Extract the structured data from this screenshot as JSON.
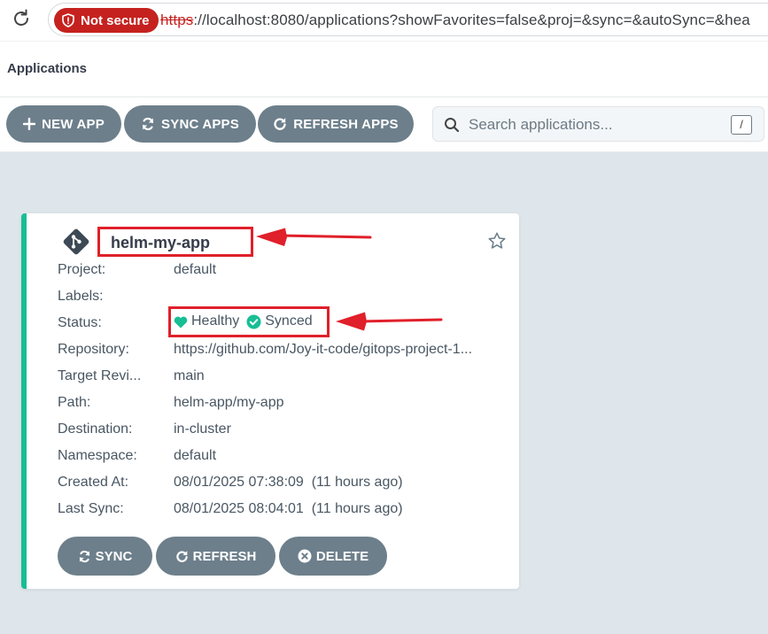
{
  "browser": {
    "security_label": "Not secure",
    "url_scheme": "https",
    "url_rest": "://localhost:8080/applications?showFavorites=false&proj=&sync=&autoSync=&hea"
  },
  "page": {
    "title": "Applications"
  },
  "toolbar": {
    "new_app_label": "NEW APP",
    "sync_apps_label": "SYNC APPS",
    "refresh_apps_label": "REFRESH APPS",
    "search_placeholder": "Search applications...",
    "search_shortcut": "/"
  },
  "app_card": {
    "name": "helm-my-app",
    "fields": [
      {
        "label": "Project:",
        "value": "default"
      },
      {
        "label": "Labels:",
        "value": ""
      },
      {
        "label": "Status:",
        "value": ""
      },
      {
        "label": "Repository:",
        "value": "https://github.com/Joy-it-code/gitops-project-1..."
      },
      {
        "label": "Target Revi...",
        "value": "main"
      },
      {
        "label": "Path:",
        "value": "helm-app/my-app"
      },
      {
        "label": "Destination:",
        "value": "in-cluster"
      },
      {
        "label": "Namespace:",
        "value": "default"
      },
      {
        "label": "Created At:",
        "value": "08/01/2025 07:38:09  (11 hours ago)"
      },
      {
        "label": "Last Sync:",
        "value": "08/01/2025 08:04:01  (11 hours ago)"
      }
    ],
    "health": "Healthy",
    "sync_status": "Synced",
    "buttons": {
      "sync": "SYNC",
      "refresh": "REFRESH",
      "delete": "DELETE"
    }
  },
  "colors": {
    "healthy": "#18be94",
    "annotation": "#e0202a",
    "button": "#6d7f8b"
  }
}
